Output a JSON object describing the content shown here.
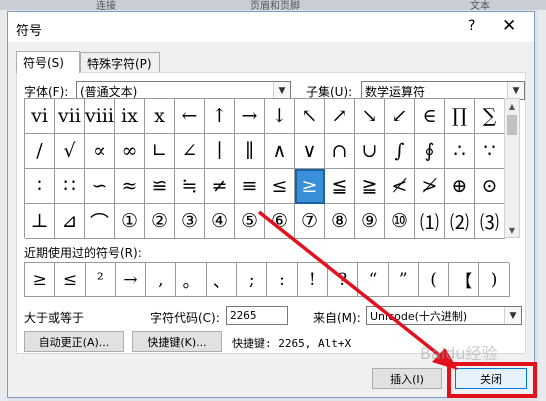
{
  "background": {
    "top_tab_1": "连接",
    "top_tab_2": "页眉和页脚",
    "top_tab_3": "文本"
  },
  "dialog": {
    "title": "符号",
    "help": "?",
    "close": "✕"
  },
  "tabs": [
    {
      "label": "符号(S)"
    },
    {
      "label": "特殊字符(P)"
    }
  ],
  "font": {
    "label": "字体(F):",
    "value": "(普通文本)"
  },
  "subset": {
    "label": "子集(U):",
    "value": "数学运算符"
  },
  "symbols": [
    "ⅵ",
    "ⅶ",
    "ⅷ",
    "ⅸ",
    "ⅹ",
    "←",
    "↑",
    "→",
    "↓",
    "↖",
    "↗",
    "↘",
    "↙",
    "∈",
    "∏",
    "∑",
    "∕",
    "√",
    "∝",
    "∞",
    "∟",
    "∠",
    "∣",
    "∥",
    "∧",
    "∨",
    "∩",
    "∪",
    "∫",
    "∮",
    "∴",
    "∵",
    "∶",
    "∷",
    "∽",
    "≈",
    "≌",
    "≒",
    "≠",
    "≡",
    "≤",
    "≥",
    "≦",
    "≧",
    "≮",
    "≯",
    "⊕",
    "⊙",
    "⊥",
    "⊿",
    "⌒",
    "①",
    "②",
    "③",
    "④",
    "⑤",
    "⑥",
    "⑦",
    "⑧",
    "⑨",
    "⑩",
    "⑴",
    "⑵",
    "⑶"
  ],
  "selected_symbol": "≥",
  "recent": {
    "label": "近期使用过的符号(R):",
    "symbols": [
      "≥",
      "≤",
      "²",
      "→",
      ",",
      "。",
      "、",
      ";",
      ":",
      "!",
      "?",
      "“",
      "”",
      "(",
      "【",
      ")"
    ]
  },
  "char_name": "大于或等于",
  "char_code": {
    "label": "字符代码(C):",
    "value": "2265"
  },
  "from": {
    "label": "来自(M):",
    "value": "Unicode(十六进制)"
  },
  "autocorrect_button": "自动更正(A)...",
  "shortcut_key_button": "快捷键(K)...",
  "shortcut_text": "快捷键: 2265, Alt+X",
  "insert_button": "插入(I)",
  "close_button": "关闭",
  "watermark": "Baidu经验",
  "colors": {
    "highlight": "#e3101e",
    "selection": "#3a8fd9"
  }
}
